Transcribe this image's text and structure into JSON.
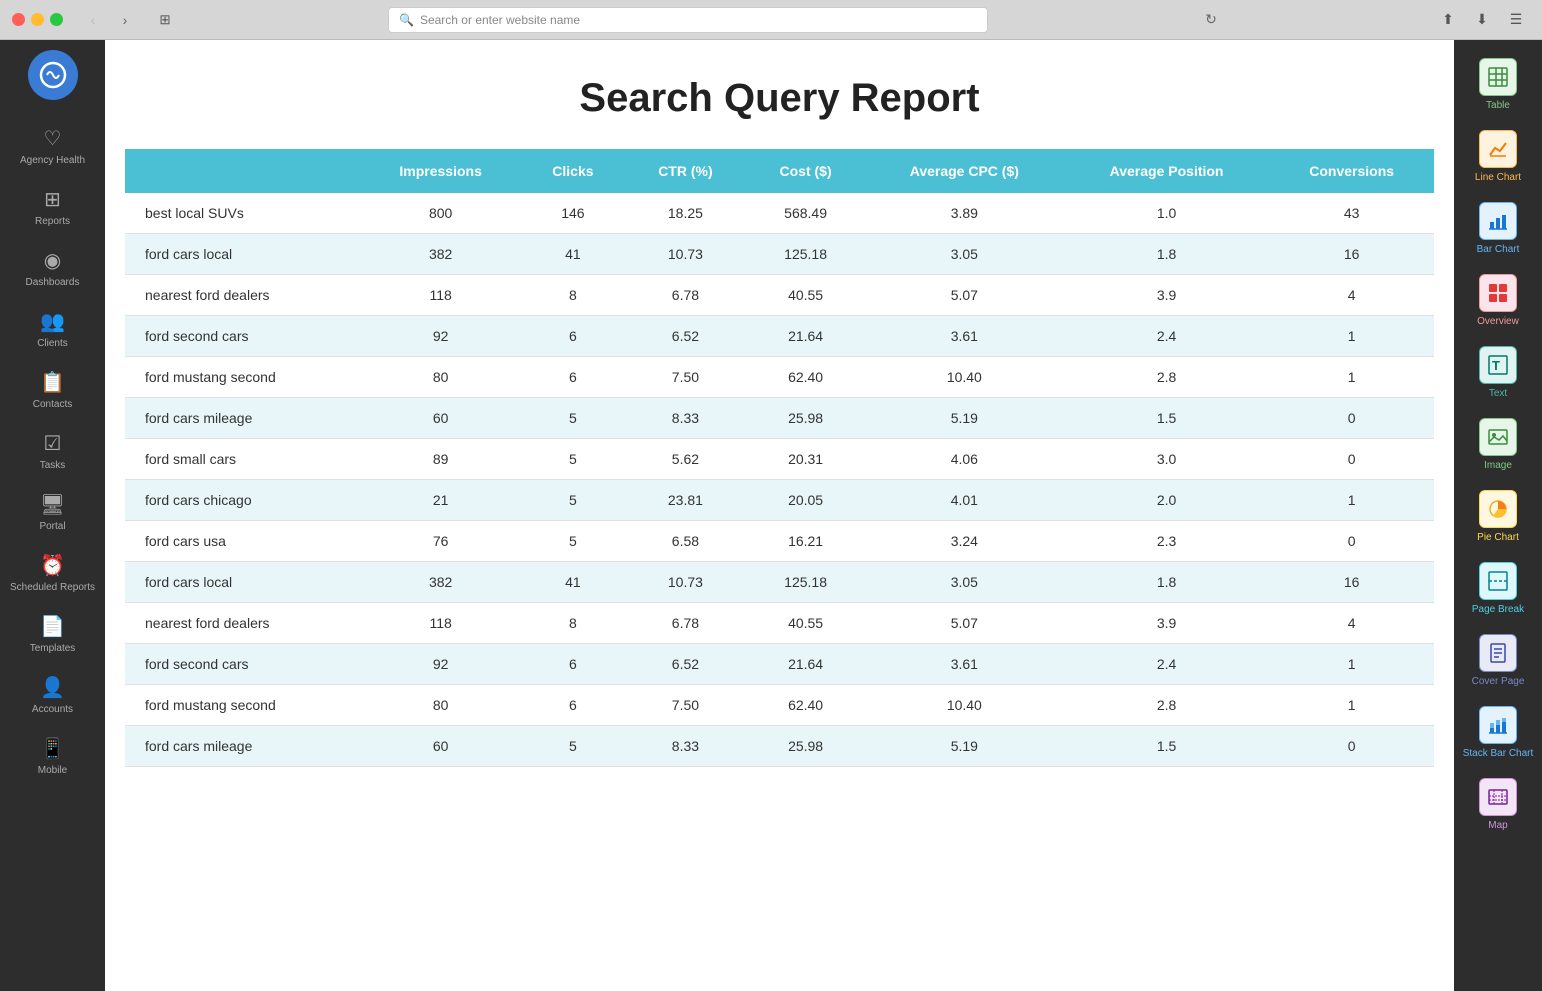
{
  "browser": {
    "address_placeholder": "Search or enter website name"
  },
  "sidebar": {
    "items": [
      {
        "id": "agency-health",
        "label": "Agency\nHealth",
        "icon": "♡"
      },
      {
        "id": "reports",
        "label": "Reports",
        "icon": "⊞"
      },
      {
        "id": "dashboards",
        "label": "Dashboards",
        "icon": "◉"
      },
      {
        "id": "clients",
        "label": "Clients",
        "icon": "👥"
      },
      {
        "id": "contacts",
        "label": "Contacts",
        "icon": "📋"
      },
      {
        "id": "tasks",
        "label": "Tasks",
        "icon": "☑"
      },
      {
        "id": "portal",
        "label": "Portal",
        "icon": "🖥"
      },
      {
        "id": "scheduled-reports",
        "label": "Scheduled\nReports",
        "icon": "⏰"
      },
      {
        "id": "templates",
        "label": "Templates",
        "icon": "📄"
      },
      {
        "id": "accounts",
        "label": "Accounts",
        "icon": "👤"
      },
      {
        "id": "mobile",
        "label": "Mobile",
        "icon": "📱"
      }
    ]
  },
  "report": {
    "title": "Search Query Report",
    "columns": [
      "Impressions",
      "Clicks",
      "CTR (%)",
      "Cost ($)",
      "Average CPC ($)",
      "Average Position",
      "Conversions"
    ],
    "rows": [
      {
        "query": "best local SUVs",
        "impressions": "800",
        "clicks": "146",
        "ctr": "18.25",
        "cost": "568.49",
        "avg_cpc": "3.89",
        "avg_pos": "1.0",
        "conversions": "43"
      },
      {
        "query": "ford cars local",
        "impressions": "382",
        "clicks": "41",
        "ctr": "10.73",
        "cost": "125.18",
        "avg_cpc": "3.05",
        "avg_pos": "1.8",
        "conversions": "16"
      },
      {
        "query": "nearest ford dealers",
        "impressions": "118",
        "clicks": "8",
        "ctr": "6.78",
        "cost": "40.55",
        "avg_cpc": "5.07",
        "avg_pos": "3.9",
        "conversions": "4"
      },
      {
        "query": "ford second cars",
        "impressions": "92",
        "clicks": "6",
        "ctr": "6.52",
        "cost": "21.64",
        "avg_cpc": "3.61",
        "avg_pos": "2.4",
        "conversions": "1"
      },
      {
        "query": "ford mustang second",
        "impressions": "80",
        "clicks": "6",
        "ctr": "7.50",
        "cost": "62.40",
        "avg_cpc": "10.40",
        "avg_pos": "2.8",
        "conversions": "1"
      },
      {
        "query": "ford cars mileage",
        "impressions": "60",
        "clicks": "5",
        "ctr": "8.33",
        "cost": "25.98",
        "avg_cpc": "5.19",
        "avg_pos": "1.5",
        "conversions": "0"
      },
      {
        "query": "ford small cars",
        "impressions": "89",
        "clicks": "5",
        "ctr": "5.62",
        "cost": "20.31",
        "avg_cpc": "4.06",
        "avg_pos": "3.0",
        "conversions": "0"
      },
      {
        "query": "ford cars chicago",
        "impressions": "21",
        "clicks": "5",
        "ctr": "23.81",
        "cost": "20.05",
        "avg_cpc": "4.01",
        "avg_pos": "2.0",
        "conversions": "1"
      },
      {
        "query": "ford cars usa",
        "impressions": "76",
        "clicks": "5",
        "ctr": "6.58",
        "cost": "16.21",
        "avg_cpc": "3.24",
        "avg_pos": "2.3",
        "conversions": "0"
      },
      {
        "query": "ford cars local",
        "impressions": "382",
        "clicks": "41",
        "ctr": "10.73",
        "cost": "125.18",
        "avg_cpc": "3.05",
        "avg_pos": "1.8",
        "conversions": "16"
      },
      {
        "query": "nearest ford dealers",
        "impressions": "118",
        "clicks": "8",
        "ctr": "6.78",
        "cost": "40.55",
        "avg_cpc": "5.07",
        "avg_pos": "3.9",
        "conversions": "4"
      },
      {
        "query": "ford second cars",
        "impressions": "92",
        "clicks": "6",
        "ctr": "6.52",
        "cost": "21.64",
        "avg_cpc": "3.61",
        "avg_pos": "2.4",
        "conversions": "1"
      },
      {
        "query": "ford mustang second",
        "impressions": "80",
        "clicks": "6",
        "ctr": "7.50",
        "cost": "62.40",
        "avg_cpc": "10.40",
        "avg_pos": "2.8",
        "conversions": "1"
      },
      {
        "query": "ford cars mileage",
        "impressions": "60",
        "clicks": "5",
        "ctr": "8.33",
        "cost": "25.98",
        "avg_cpc": "5.19",
        "avg_pos": "1.5",
        "conversions": "0"
      }
    ]
  },
  "right_panel": {
    "items": [
      {
        "id": "table",
        "label": "Table",
        "icon_color": "green",
        "icon_char": "⊞"
      },
      {
        "id": "line-chart",
        "label": "Line Chart",
        "icon_color": "orange",
        "icon_char": "📈"
      },
      {
        "id": "bar-chart",
        "label": "Bar Chart",
        "icon_color": "blue",
        "icon_char": "📊"
      },
      {
        "id": "overview",
        "label": "Overview",
        "icon_color": "red",
        "icon_char": "⊞"
      },
      {
        "id": "text",
        "label": "Text",
        "icon_color": "teal",
        "icon_char": "T"
      },
      {
        "id": "image",
        "label": "Image",
        "icon_color": "green2",
        "icon_char": "🖼"
      },
      {
        "id": "pie-chart",
        "label": "Pie Chart",
        "icon_color": "amber",
        "icon_char": "◉"
      },
      {
        "id": "page-break",
        "label": "Page Break",
        "icon_color": "teal2",
        "icon_char": "⊟"
      },
      {
        "id": "cover-page",
        "label": "Cover Page",
        "icon_color": "indigo",
        "icon_char": "📄"
      },
      {
        "id": "stack-bar-chart",
        "label": "Stack Bar Chart",
        "icon_color": "blue2",
        "icon_char": "📊"
      },
      {
        "id": "map",
        "label": "Map",
        "icon_color": "purple",
        "icon_char": "🗺"
      }
    ]
  }
}
